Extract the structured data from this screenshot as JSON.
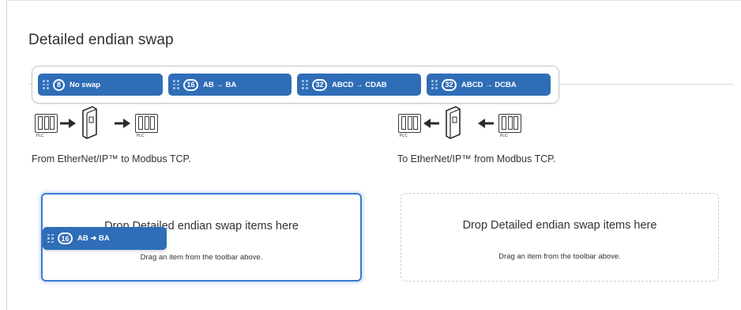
{
  "title": "Detailed endian swap",
  "toolbar": {
    "items": [
      {
        "badge": "8",
        "label": "No swap"
      },
      {
        "badge": "16",
        "label": "AB → BA"
      },
      {
        "badge": "32",
        "label": "ABCD → CDAB"
      },
      {
        "badge": "32",
        "label": "ABCD → DCBA"
      }
    ]
  },
  "diagram": {
    "plc_label": "PLC"
  },
  "left_panel": {
    "caption": "From EtherNet/IP™ to Modbus TCP.",
    "drop_title": "Drop Detailed endian swap items here",
    "drop_hint": "Drag an item from the toolbar above."
  },
  "right_panel": {
    "caption": "To EtherNet/IP™ from Modbus TCP.",
    "drop_title": "Drop Detailed endian swap items here",
    "drop_hint": "Drag an item from the toolbar above."
  },
  "drag_item": {
    "badge": "16",
    "label": "AB ➜ BA"
  },
  "colors": {
    "chip": "#2f6db7",
    "drop_active_border": "#3b7bd1",
    "drop_idle_border": "#cfcfcf"
  },
  "icons": [
    "grip-icon",
    "plc-icon",
    "gateway-icon",
    "arrow-right-icon",
    "arrow-left-icon"
  ]
}
